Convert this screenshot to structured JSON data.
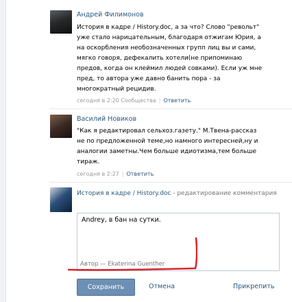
{
  "comments": [
    {
      "author": "Андрей Филимонов",
      "lines": [
        "История в кадре / History.doc, а за что? Слово \"револьт\"",
        "уже стало нарицательным, благодаря отжигам Юрия, а",
        "на оскорбления необозначенных групп лиц вы и сами,",
        "мягко говоря, дефекалить хотели(не припоминаю",
        "предов, когда он клеймил людей совками). Если уж мне",
        "пред, то автора уже давно банить пора - за",
        "многократный рецидив."
      ],
      "time": "сегодня в 2:20 Сообщества",
      "reply": "Ответить"
    },
    {
      "author": "Василий Новиков",
      "lines": [
        "\"Как я редактировал сельхоз.газету.\" М.Твена-рассказ",
        "не по предложенной теме,но намного интересней,ну и",
        "аналогии заметны.Чем больше идиотизма,тем больше",
        "тираж."
      ],
      "time": "сегодня в 2:27",
      "reply": "Ответить"
    }
  ],
  "editor": {
    "page_link": "История в кадре / History.doc",
    "title_suffix": " - редактирование комментария",
    "text": "Andrey, в бан на сутки.",
    "signature": "Автор — Ekaterina Guenther",
    "save_label": "Сохранить",
    "cancel_label": "Отмена",
    "attach_label": "Прикрепить"
  },
  "colors": {
    "link": "#2b587a",
    "annotation": "#d9242b",
    "save_button": "#6d8fb3"
  }
}
